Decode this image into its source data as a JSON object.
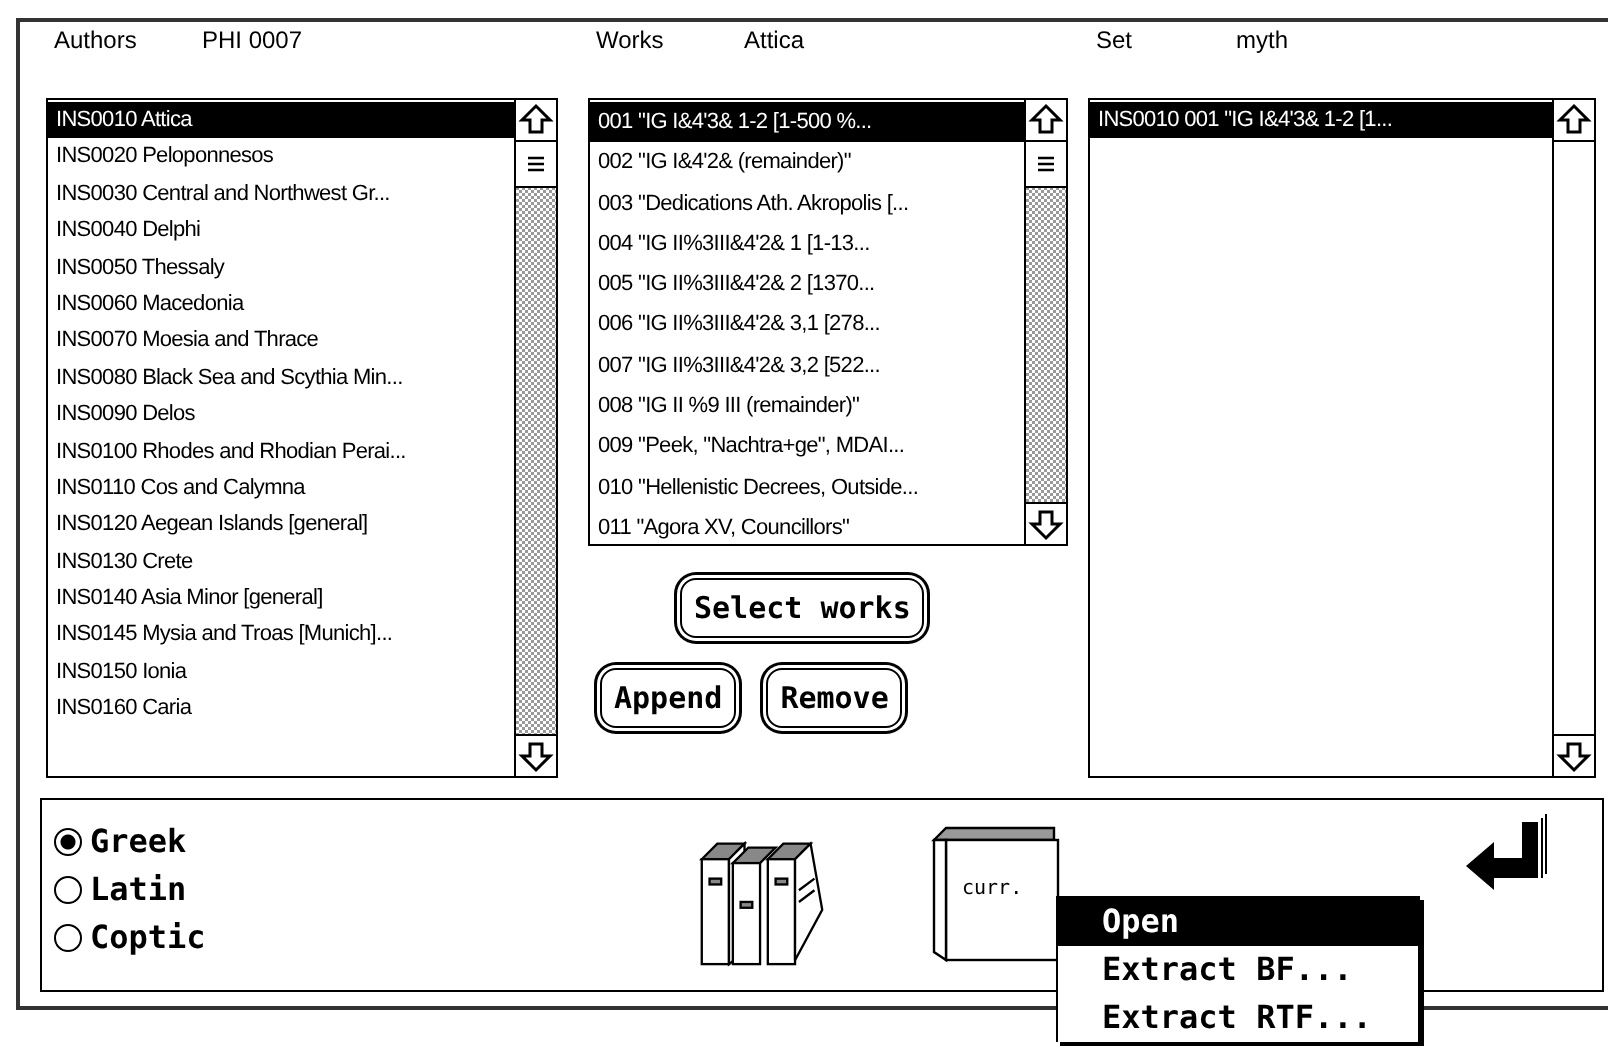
{
  "columns": [
    {
      "label": "Authors",
      "value": "PHI 0007",
      "items": [
        {
          "text": "INS0010 Attica",
          "selected": true
        },
        {
          "text": "INS0020 Peloponnesos",
          "selected": false
        },
        {
          "text": "INS0030 Central and Northwest Gr...",
          "selected": false
        },
        {
          "text": "INS0040 Delphi",
          "selected": false
        },
        {
          "text": "INS0050 Thessaly",
          "selected": false
        },
        {
          "text": "INS0060 Macedonia",
          "selected": false
        },
        {
          "text": "INS0070 Moesia and Thrace",
          "selected": false
        },
        {
          "text": "INS0080 Black Sea and Scythia Min...",
          "selected": false
        },
        {
          "text": "INS0090 Delos",
          "selected": false
        },
        {
          "text": "INS0100 Rhodes and Rhodian Perai...",
          "selected": false
        },
        {
          "text": "INS0110 Cos and Calymna",
          "selected": false
        },
        {
          "text": "INS0120 Aegean Islands [general]",
          "selected": false
        },
        {
          "text": "INS0130 Crete",
          "selected": false
        },
        {
          "text": "INS0140 Asia Minor [general]",
          "selected": false
        },
        {
          "text": "INS0145 Mysia and Troas [Munich]...",
          "selected": false
        },
        {
          "text": "INS0150 Ionia",
          "selected": false
        },
        {
          "text": "INS0160 Caria",
          "selected": false
        }
      ]
    },
    {
      "label": "Works",
      "value": "Attica",
      "items": [
        {
          "text": "001 \"IG I&4'3& 1-2 [1-500 %...",
          "selected": true
        },
        {
          "text": "002 \"IG I&4'2& (remainder)\"",
          "selected": false
        },
        {
          "text": "003 \"Dedications Ath. Akropolis [...",
          "selected": false
        },
        {
          "text": "004 \"IG II%3III&4'2& 1  [1-13...",
          "selected": false
        },
        {
          "text": "005 \"IG II%3III&4'2& 2  [1370...",
          "selected": false
        },
        {
          "text": "006 \"IG II%3III&4'2& 3,1 [278...",
          "selected": false
        },
        {
          "text": "007 \"IG II%3III&4'2& 3,2 [522...",
          "selected": false
        },
        {
          "text": "008 \"IG II %9 III (remainder)\"",
          "selected": false
        },
        {
          "text": "009 \"Peek, \"Nachtra+ge\", MDAI...",
          "selected": false
        },
        {
          "text": "010 \"Hellenistic Decrees, Outside...",
          "selected": false
        },
        {
          "text": "011 \"Agora XV, Councillors\"",
          "selected": false
        }
      ]
    },
    {
      "label": "Set",
      "value": "myth",
      "items": [
        {
          "text": "INS0010   001 \"IG I&4'3& 1-2 [1...",
          "selected": true
        }
      ]
    }
  ],
  "buttons": {
    "select": "Select works",
    "append": "Append",
    "remove": "Remove"
  },
  "languages": [
    {
      "label": "Greek",
      "selected": true
    },
    {
      "label": "Latin",
      "selected": false
    },
    {
      "label": "Coptic",
      "selected": false
    }
  ],
  "current_label": "curr.",
  "menu": [
    {
      "label": "Open",
      "selected": true
    },
    {
      "label": "Extract BF...",
      "selected": false
    },
    {
      "label": "Extract RTF...",
      "selected": false
    }
  ]
}
